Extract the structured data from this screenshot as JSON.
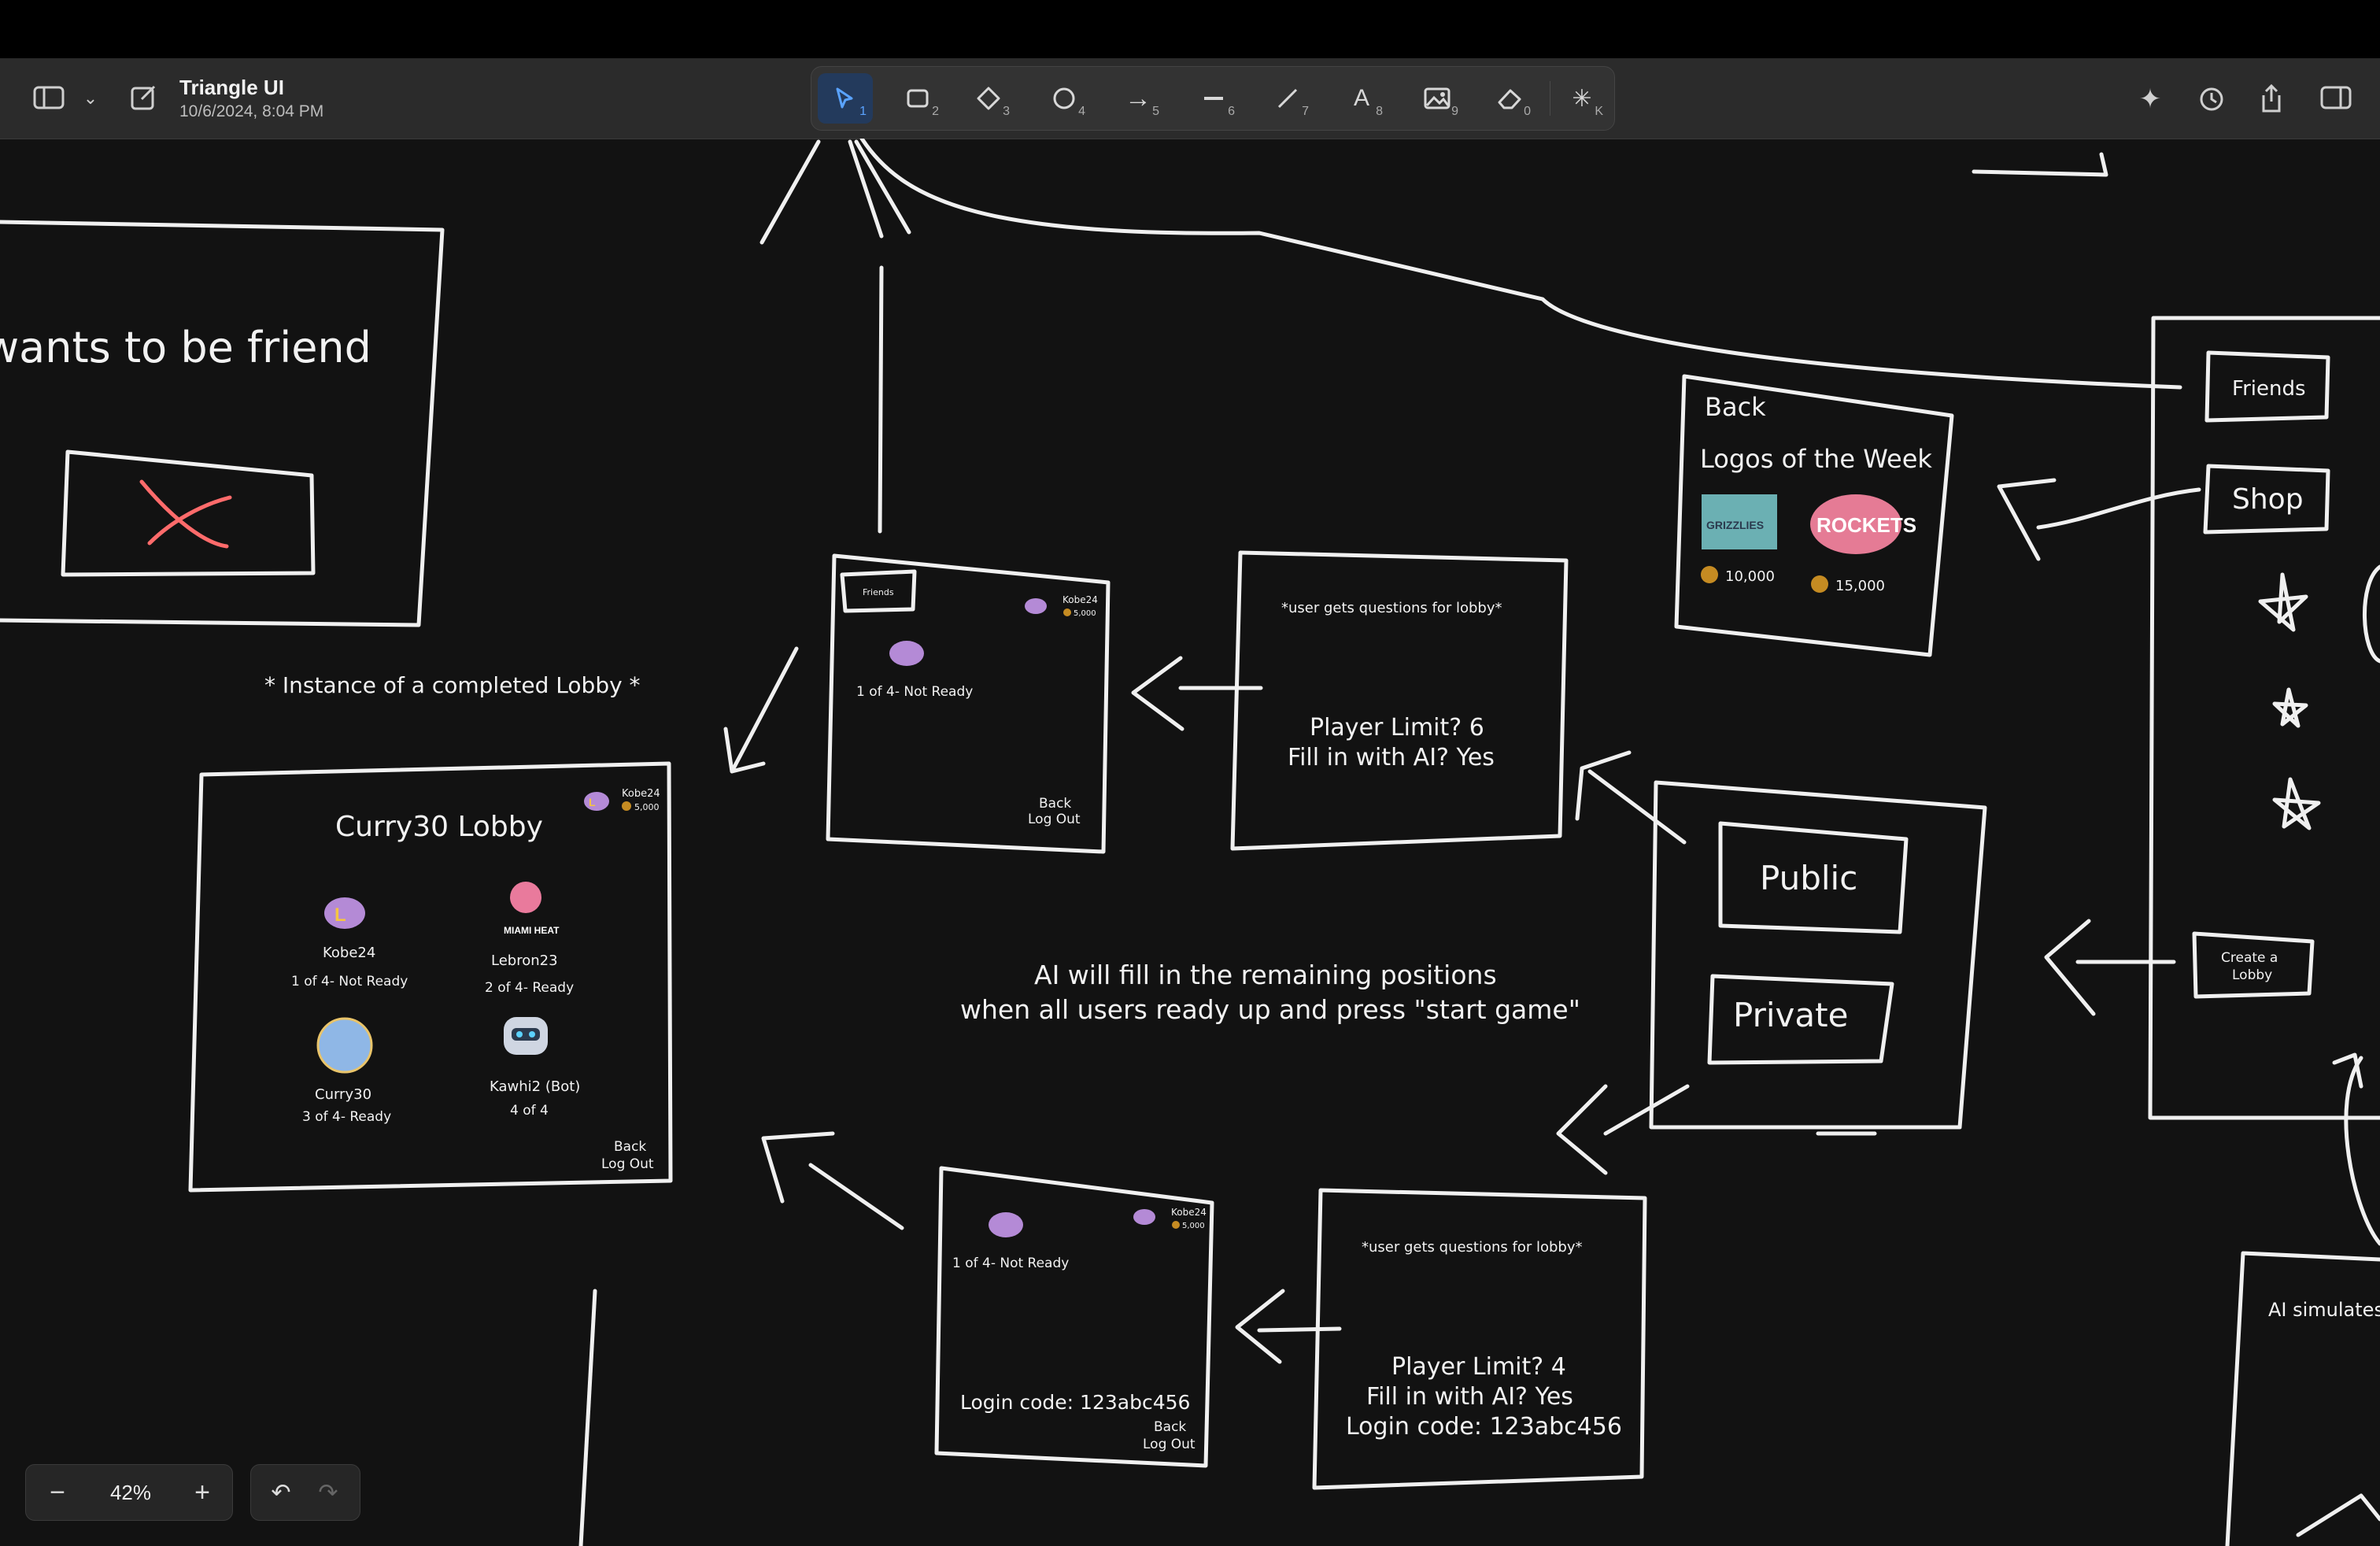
{
  "app": {
    "title": "Triangle UI",
    "date": "10/6/2024, 8:04 PM"
  },
  "tools": [
    {
      "name": "select",
      "num": "1",
      "active": true
    },
    {
      "name": "rectangle",
      "num": "2"
    },
    {
      "name": "diamond",
      "num": "3"
    },
    {
      "name": "ellipse",
      "num": "4"
    },
    {
      "name": "arrow",
      "num": "5"
    },
    {
      "name": "line",
      "num": "6"
    },
    {
      "name": "pen",
      "num": "7"
    },
    {
      "name": "text",
      "num": "8"
    },
    {
      "name": "image",
      "num": "9"
    },
    {
      "name": "eraser",
      "num": "0"
    },
    {
      "name": "laser",
      "num": "K"
    }
  ],
  "zoom": {
    "label": "42%",
    "minus": "−",
    "plus": "+"
  },
  "canvas": {
    "friend_popup": {
      "text": "wants to be friend"
    },
    "instance_note": "* Instance of a completed Lobby *",
    "lobby": {
      "title": "Curry30 Lobby",
      "user": "Kobe24",
      "coins": "5,000",
      "players": [
        {
          "name": "Kobe24",
          "status": "1 of 4- Not Ready"
        },
        {
          "name": "Lebron23",
          "status": "2 of 4- Ready"
        },
        {
          "name": "Curry30",
          "status": "3 of 4- Ready"
        },
        {
          "name": "Kawhi2 (Bot)",
          "status": "4 of 4"
        }
      ],
      "back": "Back",
      "logout": "Log Out"
    },
    "lobby_top": {
      "friends": "Friends",
      "user": "Kobe24",
      "coins": "5,000",
      "status": "1 of 4- Not Ready",
      "back": "Back",
      "logout": "Log Out"
    },
    "questions_top": {
      "header": "*user gets questions for lobby*",
      "line1": "Player Limit? 6",
      "line2": "Fill in with AI? Yes"
    },
    "shop": {
      "back": "Back",
      "title": "Logos of the Week",
      "price1": "10,000",
      "price2": "15,000",
      "logo1": "GRIZZLIES",
      "logo2": "ROCKETS"
    },
    "menu": {
      "friends": "Friends",
      "shop": "Shop",
      "create": "Create a",
      "create2": "Lobby"
    },
    "public_private": {
      "public": "Public",
      "private": "Private"
    },
    "ai_note": {
      "line1": "AI will fill in the remaining positions",
      "line2": "when all users ready up and press \"start game\""
    },
    "lobby_bottom": {
      "user": "Kobe24",
      "coins": "5,000",
      "status": "1 of 4- Not Ready",
      "code": "Login code: 123abc456",
      "back": "Back",
      "logout": "Log Out"
    },
    "questions_bottom": {
      "header": "*user gets questions for lobby*",
      "line1": "Player Limit? 4",
      "line2": "Fill in with AI? Yes",
      "line3": "Login code: 123abc456"
    },
    "ai_sim": "AI simulates"
  },
  "colors": {
    "accent": "#5aa3ff",
    "sketch": "#f2f2f2",
    "red": "#ff6b6b",
    "lakers": "#b48ad6",
    "heat": "#e97a9c",
    "warriors": "#8fb7e6"
  }
}
